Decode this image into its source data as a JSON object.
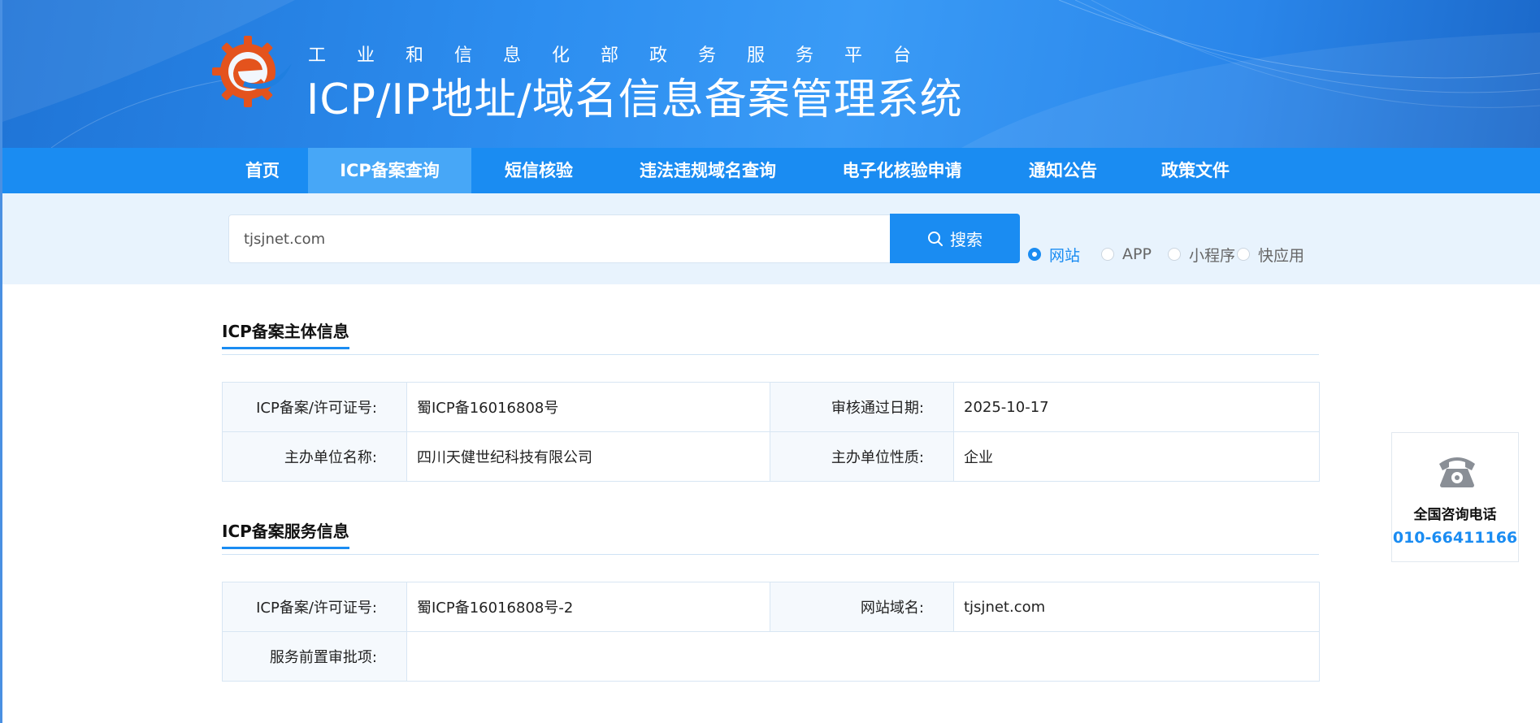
{
  "header": {
    "org_name": "工业和信息化部政务服务平台",
    "system_title": "ICP/IP地址/域名信息备案管理系统",
    "logo_icon": "miit-gear-e-logo-icon"
  },
  "nav": {
    "items": [
      {
        "label": "首页"
      },
      {
        "label": "ICP备案查询",
        "active": true
      },
      {
        "label": "短信核验"
      },
      {
        "label": "违法违规域名查询"
      },
      {
        "label": "电子化核验申请"
      },
      {
        "label": "通知公告"
      },
      {
        "label": "政策文件"
      }
    ]
  },
  "search": {
    "value": "tjsjnet.com",
    "button_label": "搜索",
    "button_icon": "search-icon",
    "types": [
      {
        "label": "网站",
        "checked": true
      },
      {
        "label": "APP",
        "checked": false
      },
      {
        "label": "小程序",
        "checked": false
      },
      {
        "label": "快应用",
        "checked": false
      }
    ]
  },
  "subject_info": {
    "title": "ICP备案主体信息",
    "rows": [
      [
        {
          "label": "ICP备案/许可证号:",
          "value": "蜀ICP备16016808号"
        },
        {
          "label": "审核通过日期:",
          "value": "2025-10-17"
        }
      ],
      [
        {
          "label": "主办单位名称:",
          "value": "四川天健世纪科技有限公司"
        },
        {
          "label": "主办单位性质:",
          "value": "企业"
        }
      ]
    ]
  },
  "service_info": {
    "title": "ICP备案服务信息",
    "license_label": "ICP备案/许可证号:",
    "license_value": "蜀ICP备16016808号-2",
    "domain_label": "网站域名:",
    "domain_value": "tjsjnet.com",
    "preapproval_label": "服务前置审批项:",
    "preapproval_value": ""
  },
  "contact": {
    "icon": "telephone-icon",
    "title": "全国咨询电话",
    "phone": "010-66411166"
  },
  "colors": {
    "primary": "#1a8cf2",
    "nav_active": "#47a7f7",
    "search_band": "#e8f3fd"
  }
}
